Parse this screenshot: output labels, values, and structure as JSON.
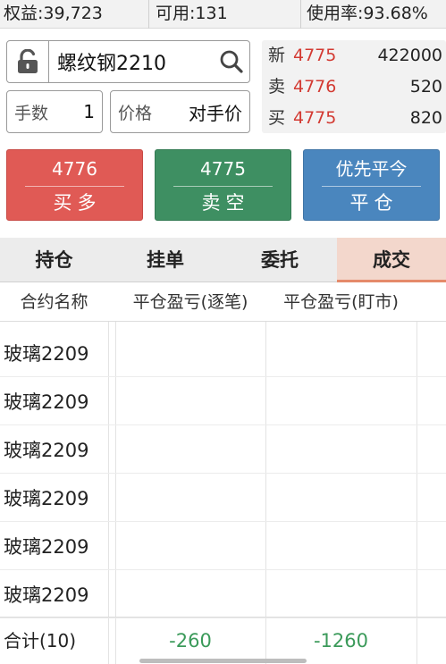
{
  "account": {
    "equity_label": "权益:39,723",
    "available_label": "可用:131",
    "usage_label": "使用率:93.68%"
  },
  "order": {
    "symbol": "螺纹钢2210",
    "qty_label": "手数",
    "qty_value": "1",
    "price_label": "价格",
    "price_value": "对手价"
  },
  "quote": {
    "rows": [
      {
        "label": "新",
        "price": "4775",
        "volume": "422000"
      },
      {
        "label": "卖",
        "price": "4776",
        "volume": "520"
      },
      {
        "label": "买",
        "price": "4775",
        "volume": "820"
      }
    ]
  },
  "buttons": {
    "buy": {
      "price": "4776",
      "label": "买多"
    },
    "sell": {
      "price": "4775",
      "label": "卖空"
    },
    "close": {
      "top": "优先平今",
      "label": "平仓"
    }
  },
  "tabs": [
    {
      "label": "持仓",
      "active": false
    },
    {
      "label": "挂单",
      "active": false
    },
    {
      "label": "委托",
      "active": false
    },
    {
      "label": "成交",
      "active": true
    }
  ],
  "table": {
    "columns": [
      "合约名称",
      "平仓盈亏(逐笔)",
      "平仓盈亏(盯市)"
    ],
    "rows": [
      {
        "name": "玻璃2209"
      },
      {
        "name": "玻璃2209"
      },
      {
        "name": "玻璃2209"
      },
      {
        "name": "玻璃2209"
      },
      {
        "name": "玻璃2209"
      },
      {
        "name": "玻璃2209"
      }
    ],
    "total": {
      "label": "合计(10)",
      "per_trade": "-260",
      "mark_to_market": "-1260"
    }
  },
  "colors": {
    "buy": "#e05a55",
    "sell": "#3e8f62",
    "close": "#4a86be",
    "price_red": "#d33a32",
    "profit_green": "#3b9a5a",
    "active_tab": "#f3d7cc"
  },
  "icons": {
    "lock": "unlocked-padlock-icon",
    "search": "magnifier-icon"
  }
}
